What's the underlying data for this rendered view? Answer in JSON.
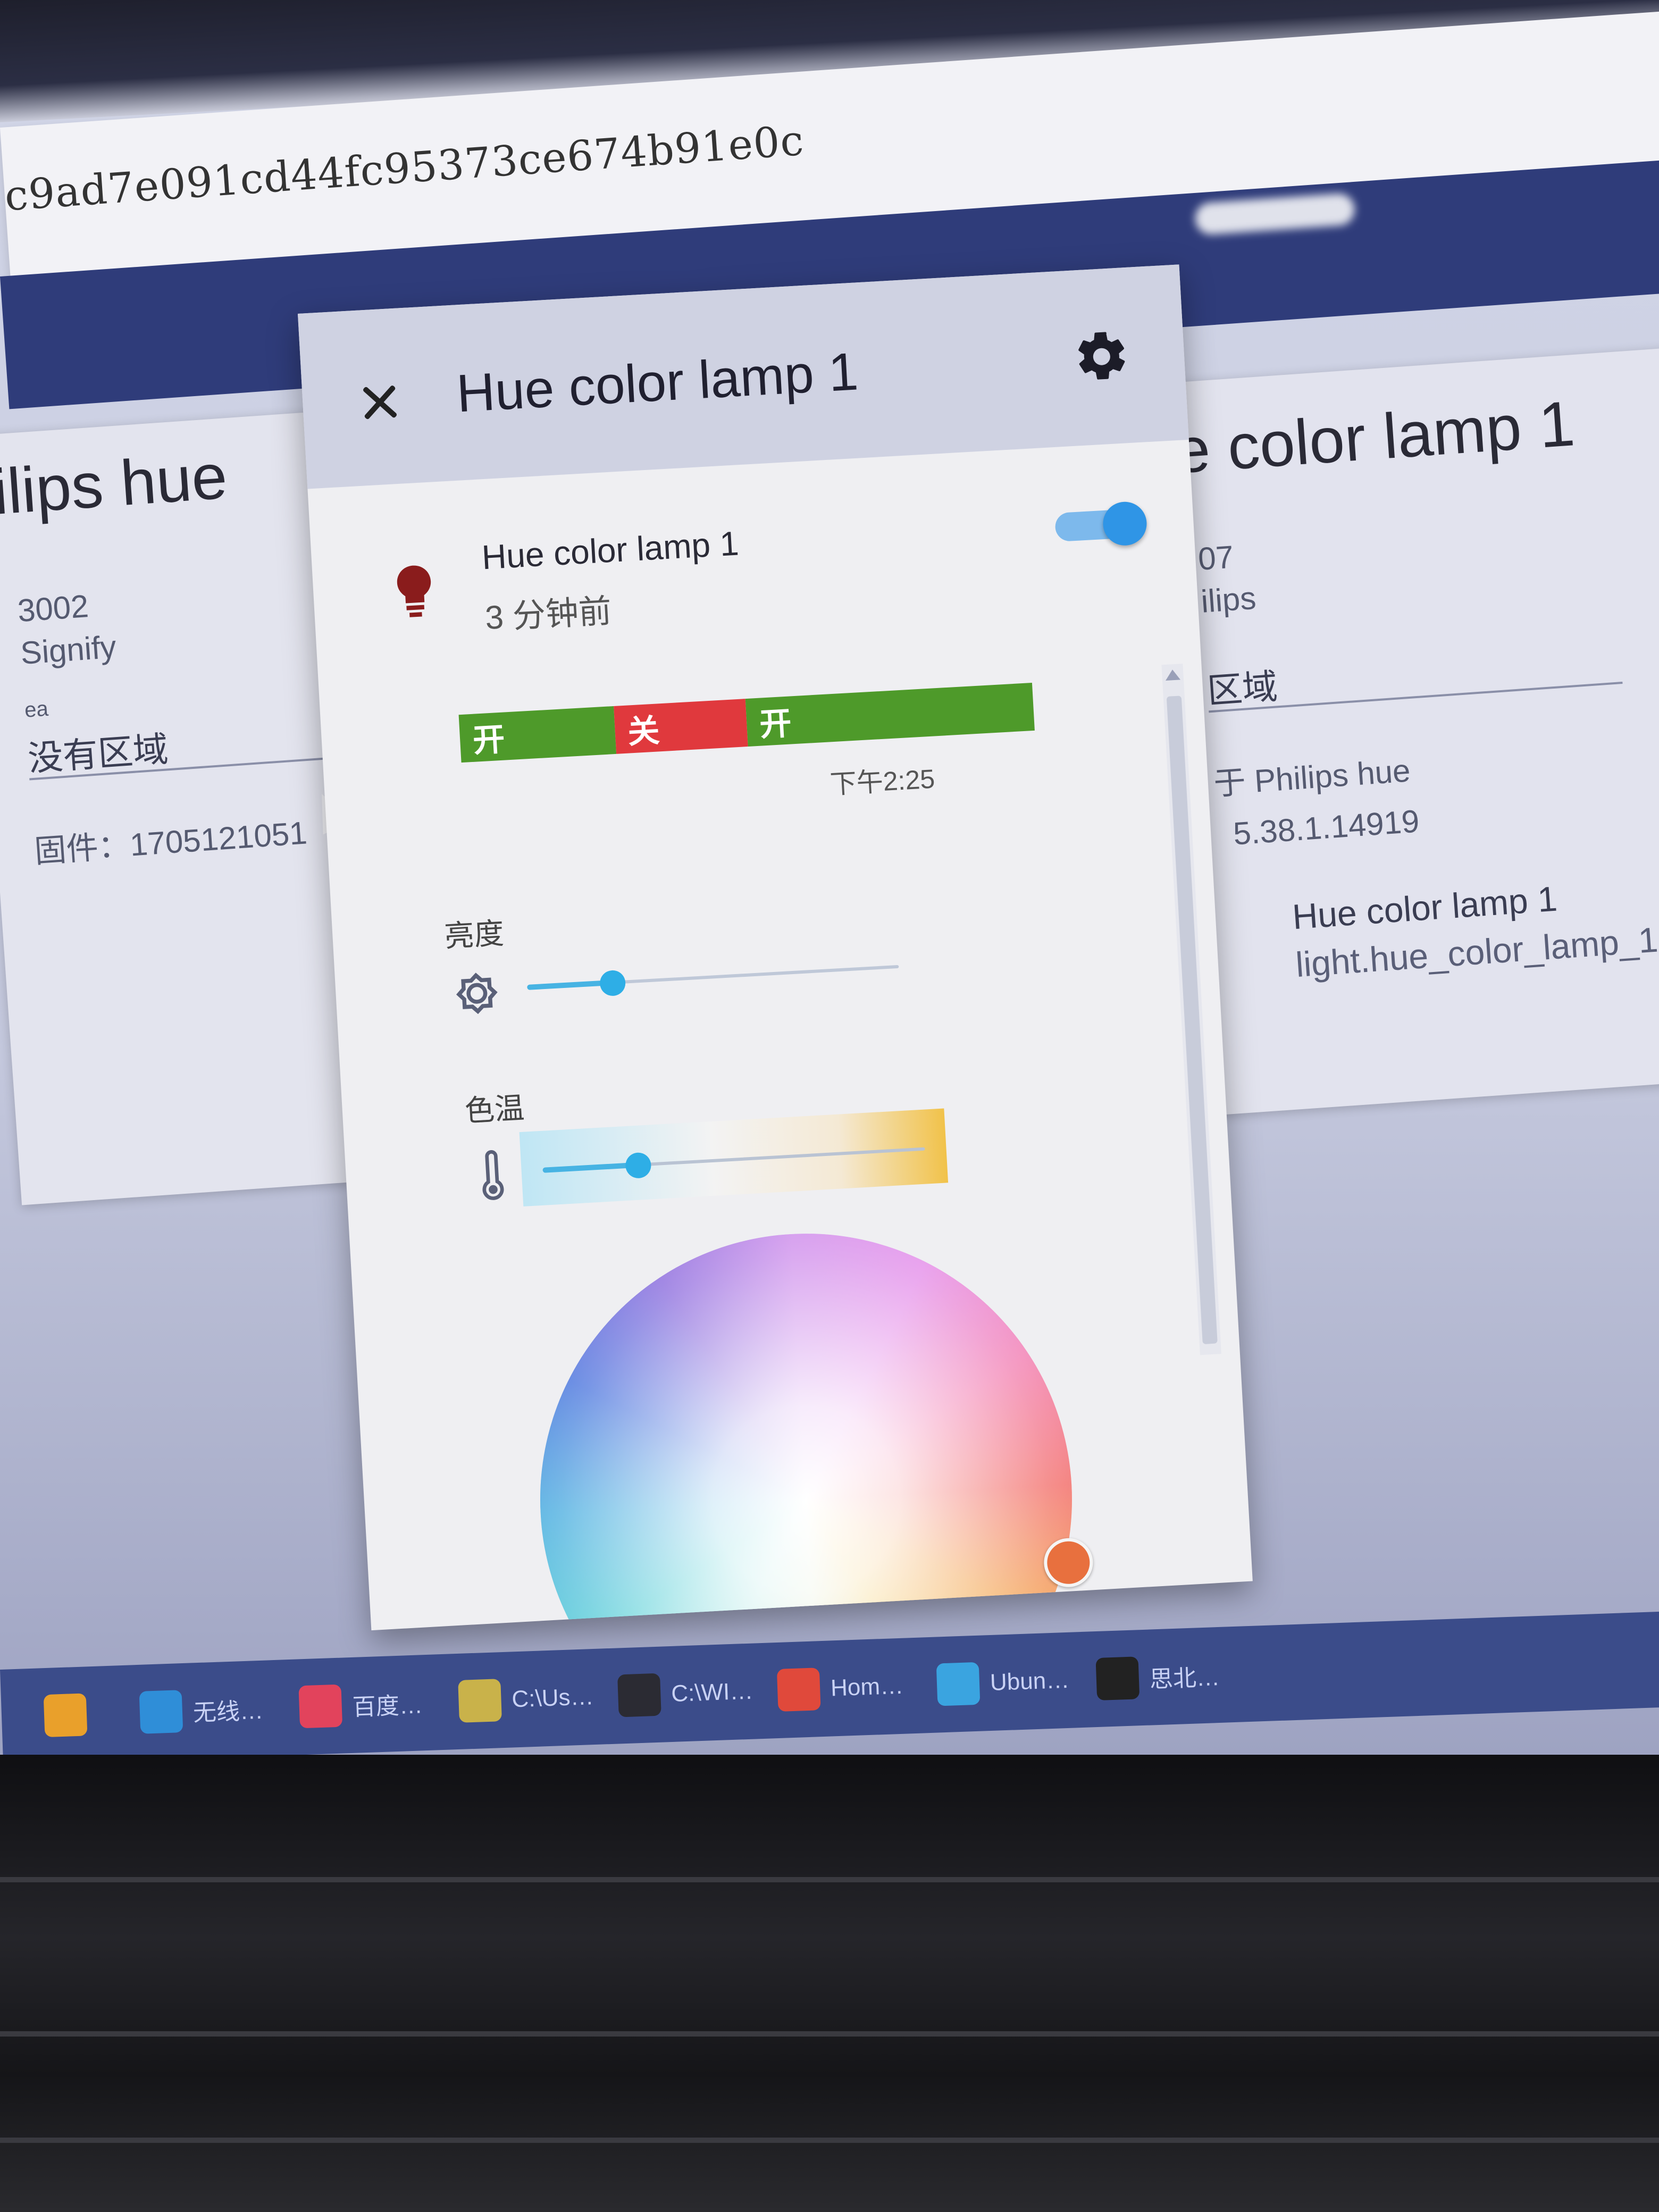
{
  "browser": {
    "url": "c9ad7e091cd44fc95373ce674b91e0c"
  },
  "background_left": {
    "title": "ilips hue",
    "model": "3002",
    "manufacturer": "Signify",
    "area_label": "ea",
    "area_value": "没有区域",
    "firmware": "固件：1705121051"
  },
  "background_right": {
    "title": "e color lamp 1",
    "model": "07",
    "manufacturer": "ilips",
    "area_value": "区域",
    "via": "于 Philips hue",
    "version": "5.38.1.14919",
    "entity_name": "Hue color lamp 1",
    "entity_id": "light.hue_color_lamp_1"
  },
  "dialog": {
    "title": "Hue color lamp 1",
    "entity_name": "Hue color lamp 1",
    "last_changed": "3 分钟前",
    "toggle_on": true,
    "history": [
      {
        "state": "开",
        "color": "#4e9a2a",
        "fraction": 0.27
      },
      {
        "state": "关",
        "color": "#e0393d",
        "fraction": 0.23
      },
      {
        "state": "开",
        "color": "#4e9a2a",
        "fraction": 0.5
      }
    ],
    "history_time": "下午2:25",
    "brightness_label": "亮度",
    "brightness_value": 0.23,
    "color_temp_label": "色温",
    "color_temp_value": 0.25,
    "wheel_marker_color": "#e8703e"
  },
  "taskbar": {
    "items": [
      {
        "label": "",
        "icon": "store-icon",
        "color": "#e9a02b"
      },
      {
        "label": "无线…",
        "icon": "edge-icon",
        "color": "#2f8ed8"
      },
      {
        "label": "百度…",
        "icon": "browser-icon",
        "color": "#e2435c"
      },
      {
        "label": "C:\\Us…",
        "icon": "notepad-icon",
        "color": "#c9b24a"
      },
      {
        "label": "C:\\WI…",
        "icon": "console-icon",
        "color": "#2b2b33"
      },
      {
        "label": "Hom…",
        "icon": "chrome-icon",
        "color": "#e0493b"
      },
      {
        "label": "Ubun…",
        "icon": "vm-icon",
        "color": "#3aa4e0"
      },
      {
        "label": "思北…",
        "icon": "qq-icon",
        "color": "#222"
      }
    ]
  }
}
